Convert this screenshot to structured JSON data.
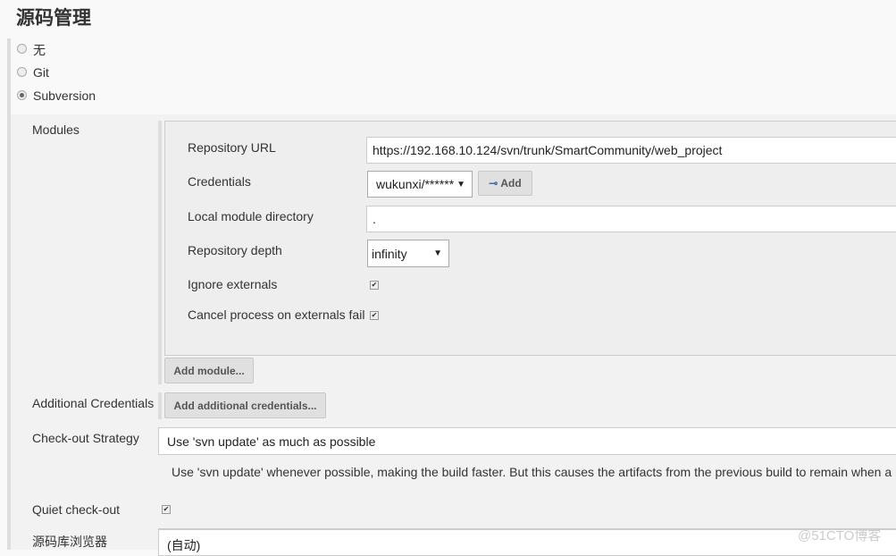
{
  "section_title": "源码管理",
  "scm_options": [
    {
      "label": "无",
      "selected": false
    },
    {
      "label": "Git",
      "selected": false
    },
    {
      "label": "Subversion",
      "selected": true
    }
  ],
  "modules": {
    "label": "Modules",
    "repository_url_label": "Repository URL",
    "repository_url": "https://192.168.10.124/svn/trunk/SmartCommunity/web_project",
    "credentials_label": "Credentials",
    "credentials_value": "wukunxi/******",
    "add_button": "Add",
    "local_dir_label": "Local module directory",
    "local_dir": ".",
    "depth_label": "Repository depth",
    "depth_value": "infinity",
    "ignore_externals_label": "Ignore externals",
    "ignore_externals": true,
    "cancel_externals_label": "Cancel process on externals fail",
    "cancel_externals": true,
    "add_module_button": "Add module..."
  },
  "additional_credentials": {
    "label": "Additional Credentials",
    "button": "Add additional credentials..."
  },
  "checkout_strategy": {
    "label": "Check-out Strategy",
    "value": "Use 'svn update' as much as possible",
    "help": "Use 'svn update' whenever possible, making the build faster. But this causes the artifacts from the previous build to remain when a new b"
  },
  "quiet_checkout": {
    "label": "Quiet check-out",
    "checked": true
  },
  "repo_browser": {
    "label": "源码库浏览器",
    "value": "(自动)"
  },
  "watermark": "@51CTO博客"
}
